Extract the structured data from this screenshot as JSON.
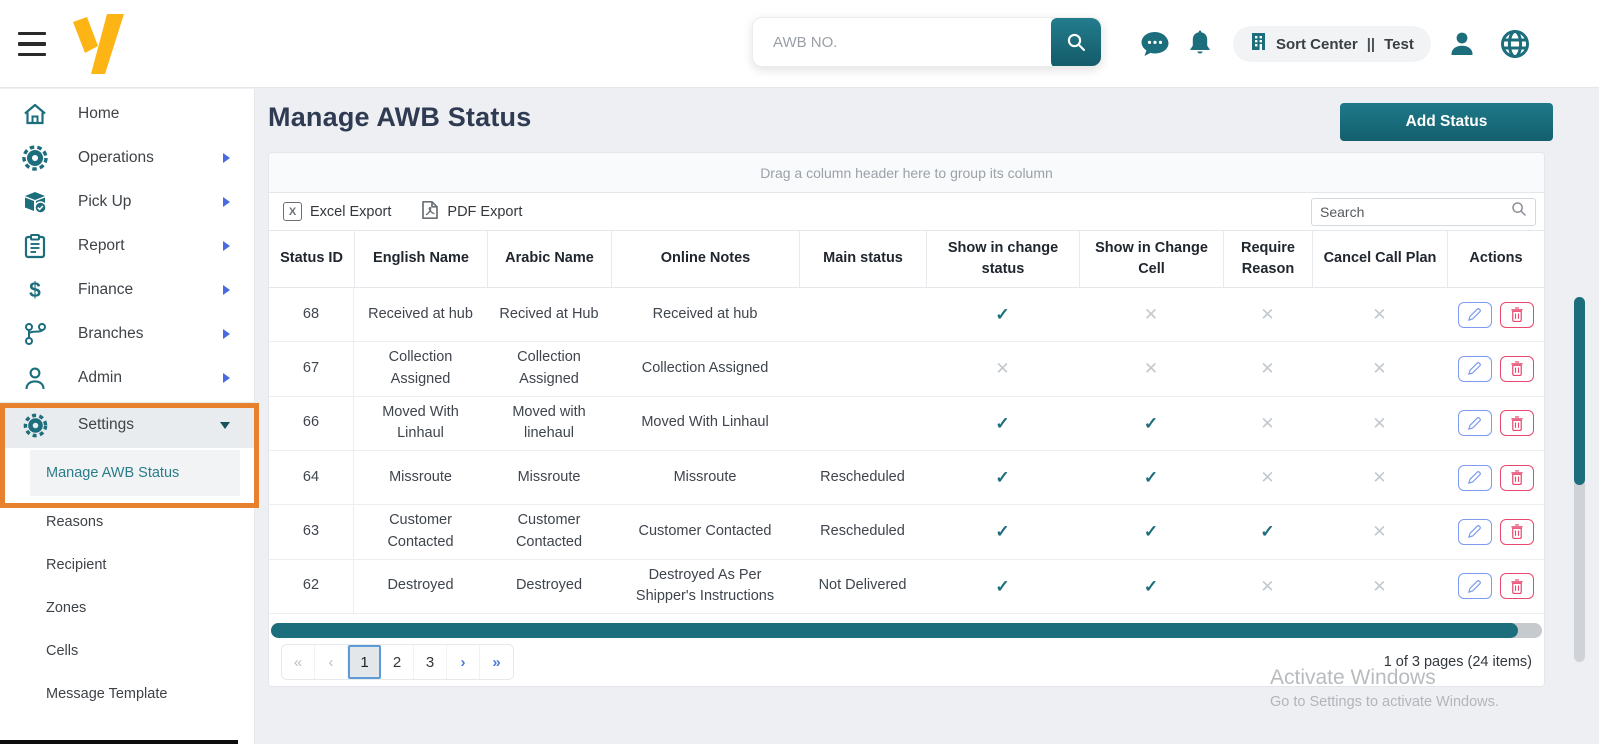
{
  "colors": {
    "accent_teal": "#1d6e7d",
    "logo_yellow": "#fdb515",
    "annotation_orange": "#e8812e",
    "chevron_blue": "#4a6be0",
    "edit_blue": "#7d9bf0",
    "delete_pink": "#e8486e",
    "check_teal": "#1d6e7d",
    "cross_grey": "#c3c9cf",
    "title_navy": "#2f3b52"
  },
  "topbar": {
    "search_placeholder": "AWB NO.",
    "badge": {
      "facility": "Sort Center",
      "separator": "||",
      "environment": "Test"
    }
  },
  "sidebar": {
    "items": [
      {
        "label": "Home",
        "icon": "home-icon"
      },
      {
        "label": "Operations",
        "icon": "operations-icon"
      },
      {
        "label": "Pick Up",
        "icon": "pickup-icon"
      },
      {
        "label": "Report",
        "icon": "report-icon"
      },
      {
        "label": "Finance",
        "icon": "finance-icon"
      },
      {
        "label": "Branches",
        "icon": "branches-icon"
      },
      {
        "label": "Admin",
        "icon": "admin-icon"
      },
      {
        "label": "Settings",
        "icon": "settings-icon"
      }
    ],
    "finance_icon_glyph": "$",
    "submenu": [
      {
        "label": "Manage AWB Status",
        "active": true
      },
      {
        "label": "Reasons"
      },
      {
        "label": "Recipient"
      },
      {
        "label": "Zones"
      },
      {
        "label": "Cells"
      },
      {
        "label": "Message Template"
      }
    ]
  },
  "page": {
    "title": "Manage AWB Status",
    "add_status_button": "Add Status"
  },
  "grid": {
    "group_hint": "Drag a column header here to group its column",
    "toolbar": {
      "excel_export": "Excel Export",
      "excel_icon_glyph": "X",
      "pdf_export": "PDF Export",
      "search_placeholder": "Search"
    },
    "columns": [
      "Status ID",
      "English Name",
      "Arabic Name",
      "Online Notes",
      "Main status",
      "Show in change status",
      "Show in Change Cell",
      "Require Reason",
      "Cancel Call Plan",
      "Actions"
    ],
    "rows": [
      {
        "status_id": "68",
        "english_name": "Received at hub",
        "arabic_name": "Recived at Hub",
        "online_notes": "Received at hub",
        "main_status": "",
        "show_in_change_status": true,
        "show_in_change_cell": false,
        "require_reason": false,
        "cancel_call_plan": false
      },
      {
        "status_id": "67",
        "english_name": "Collection Assigned",
        "arabic_name": "Collection Assigned",
        "online_notes": "Collection Assigned",
        "main_status": "",
        "show_in_change_status": false,
        "show_in_change_cell": false,
        "require_reason": false,
        "cancel_call_plan": false
      },
      {
        "status_id": "66",
        "english_name": "Moved With Linhaul",
        "arabic_name": "Moved with linehaul",
        "online_notes": "Moved With Linhaul",
        "main_status": "",
        "show_in_change_status": true,
        "show_in_change_cell": true,
        "require_reason": false,
        "cancel_call_plan": false
      },
      {
        "status_id": "64",
        "english_name": "Missroute",
        "arabic_name": "Missroute",
        "online_notes": "Missroute",
        "main_status": "Rescheduled",
        "show_in_change_status": true,
        "show_in_change_cell": true,
        "require_reason": false,
        "cancel_call_plan": false
      },
      {
        "status_id": "63",
        "english_name": "Customer Contacted",
        "arabic_name": "Customer Contacted",
        "online_notes": "Customer Contacted",
        "main_status": "Rescheduled",
        "show_in_change_status": true,
        "show_in_change_cell": true,
        "require_reason": true,
        "cancel_call_plan": false
      },
      {
        "status_id": "62",
        "english_name": "Destroyed",
        "arabic_name": "Destroyed",
        "online_notes": "Destroyed As Per Shipper's Instructions",
        "main_status": "Not Delivered",
        "show_in_change_status": true,
        "show_in_change_cell": true,
        "require_reason": false,
        "cancel_call_plan": false
      }
    ],
    "pagination": {
      "first": "«",
      "prev": "‹",
      "pages": [
        "1",
        "2",
        "3"
      ],
      "current_page": "1",
      "next": "›",
      "last": "»",
      "summary": "1 of 3 pages (24 items)"
    }
  },
  "watermark": {
    "line1": "Activate Windows",
    "line2": "Go to Settings to activate Windows."
  }
}
